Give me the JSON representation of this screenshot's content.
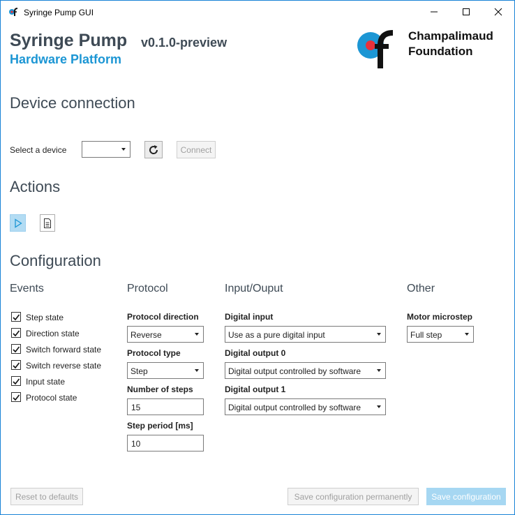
{
  "window": {
    "title": "Syringe Pump GUI",
    "controls": {
      "minimize": "minimize-icon",
      "maximize": "maximize-icon",
      "close": "close-icon"
    }
  },
  "header": {
    "title": "Syringe Pump",
    "version": "v0.1.0-preview",
    "subtitle": "Hardware Platform",
    "logo_line1": "Champalimaud",
    "logo_line2": "Foundation",
    "colors": {
      "title": "#3e4a55",
      "subtitle": "#1c96d4",
      "logo_blue": "#1c96d4",
      "logo_red": "#e8313b"
    }
  },
  "connection": {
    "heading": "Device connection",
    "select_label": "Select a device",
    "device_value": "",
    "refresh_icon": "refresh-icon",
    "connect_label": "Connect"
  },
  "actions": {
    "heading": "Actions",
    "play_icon": "play-icon",
    "document_icon": "document-icon"
  },
  "configuration": {
    "heading": "Configuration",
    "events": {
      "heading": "Events",
      "items": [
        {
          "label": "Step state",
          "checked": true
        },
        {
          "label": "Direction state",
          "checked": true
        },
        {
          "label": "Switch forward state",
          "checked": true
        },
        {
          "label": "Switch reverse state",
          "checked": true
        },
        {
          "label": "Input state",
          "checked": true
        },
        {
          "label": "Protocol state",
          "checked": true
        }
      ]
    },
    "protocol": {
      "heading": "Protocol",
      "direction_label": "Protocol direction",
      "direction_value": "Reverse",
      "type_label": "Protocol type",
      "type_value": "Step",
      "steps_label": "Number of steps",
      "steps_value": "15",
      "period_label": "Step period [ms]",
      "period_value": "10"
    },
    "io": {
      "heading": "Input/Ouput",
      "digital_input_label": "Digital input",
      "digital_input_value": "Use as a pure digital input",
      "do0_label": "Digital output 0",
      "do0_value": "Digital output controlled by software",
      "do1_label": "Digital output 1",
      "do1_value": "Digital output controlled by software"
    },
    "other": {
      "heading": "Other",
      "microstep_label": "Motor microstep",
      "microstep_value": "Full step"
    }
  },
  "footer": {
    "reset_label": "Reset to defaults",
    "save_perm_label": "Save configuration permanently",
    "save_label": "Save configuration"
  }
}
